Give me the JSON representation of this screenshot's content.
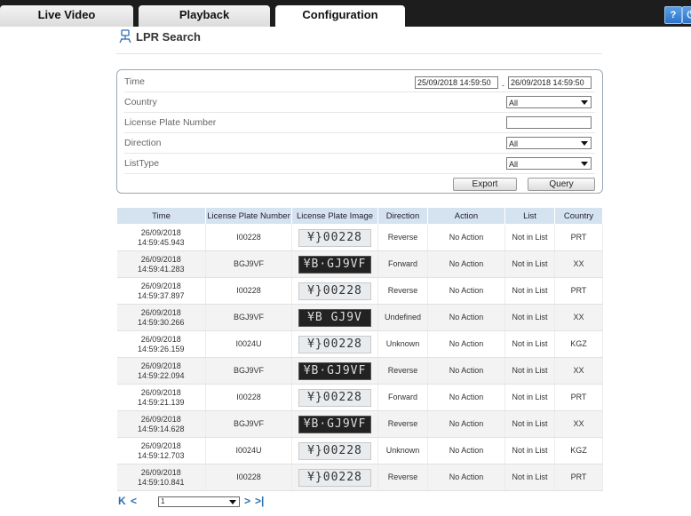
{
  "tabs": [
    {
      "label": "Live Video"
    },
    {
      "label": "Playback"
    },
    {
      "label": "Configuration"
    }
  ],
  "page_title": "LPR Search",
  "filter": {
    "time_label": "Time",
    "time_start": "25/09/2018 14:59:50",
    "time_separator": "-",
    "time_end": "26/09/2018 14:59:50",
    "country_label": "Country",
    "country_value": "All",
    "plate_label": "License Plate Number",
    "plate_value": "",
    "direction_label": "Direction",
    "direction_value": "All",
    "listtype_label": "ListType",
    "listtype_value": "All",
    "export_label": "Export",
    "query_label": "Query"
  },
  "table": {
    "headers": [
      "Time",
      "License Plate Number",
      "License Plate Image",
      "Direction",
      "Action",
      "List",
      "Country"
    ],
    "rows": [
      {
        "date": "26/09/2018",
        "time": "14:59:45.943",
        "plate": "I00228",
        "image": "¥}00228",
        "image_style": "light",
        "direction": "Reverse",
        "action": "No Action",
        "list": "Not in List",
        "country": "PRT"
      },
      {
        "date": "26/09/2018",
        "time": "14:59:41.283",
        "plate": "BGJ9VF",
        "image": "¥B·GJ9VF",
        "image_style": "dark",
        "direction": "Forward",
        "action": "No Action",
        "list": "Not in List",
        "country": "XX"
      },
      {
        "date": "26/09/2018",
        "time": "14:59:37.897",
        "plate": "I00228",
        "image": "¥}00228",
        "image_style": "light",
        "direction": "Reverse",
        "action": "No Action",
        "list": "Not in List",
        "country": "PRT"
      },
      {
        "date": "26/09/2018",
        "time": "14:59:30.266",
        "plate": "BGJ9VF",
        "image": "¥B GJ9V",
        "image_style": "dark",
        "direction": "Undefined",
        "action": "No Action",
        "list": "Not in List",
        "country": "XX"
      },
      {
        "date": "26/09/2018",
        "time": "14:59:26.159",
        "plate": "I0024U",
        "image": "¥}00228",
        "image_style": "light",
        "direction": "Unknown",
        "action": "No Action",
        "list": "Not in List",
        "country": "KGZ"
      },
      {
        "date": "26/09/2018",
        "time": "14:59:22.094",
        "plate": "BGJ9VF",
        "image": "¥B·GJ9VF",
        "image_style": "dark",
        "direction": "Reverse",
        "action": "No Action",
        "list": "Not in List",
        "country": "XX"
      },
      {
        "date": "26/09/2018",
        "time": "14:59:21.139",
        "plate": "I00228",
        "image": "¥}00228",
        "image_style": "light",
        "direction": "Forward",
        "action": "No Action",
        "list": "Not in List",
        "country": "PRT"
      },
      {
        "date": "26/09/2018",
        "time": "14:59:14.628",
        "plate": "BGJ9VF",
        "image": "¥B·GJ9VF",
        "image_style": "dark",
        "direction": "Reverse",
        "action": "No Action",
        "list": "Not in List",
        "country": "XX"
      },
      {
        "date": "26/09/2018",
        "time": "14:59:12.703",
        "plate": "I0024U",
        "image": "¥}00228",
        "image_style": "light",
        "direction": "Unknown",
        "action": "No Action",
        "list": "Not in List",
        "country": "KGZ"
      },
      {
        "date": "26/09/2018",
        "time": "14:59:10.841",
        "plate": "I00228",
        "image": "¥}00228",
        "image_style": "light",
        "direction": "Reverse",
        "action": "No Action",
        "list": "Not in List",
        "country": "PRT"
      }
    ]
  },
  "pager": {
    "first": "K",
    "prev": "<",
    "page_value": "1",
    "next": ">",
    "last": ">|"
  },
  "icons": {
    "help": "help-icon",
    "logout": "logout-icon",
    "title": "search-car-icon"
  }
}
